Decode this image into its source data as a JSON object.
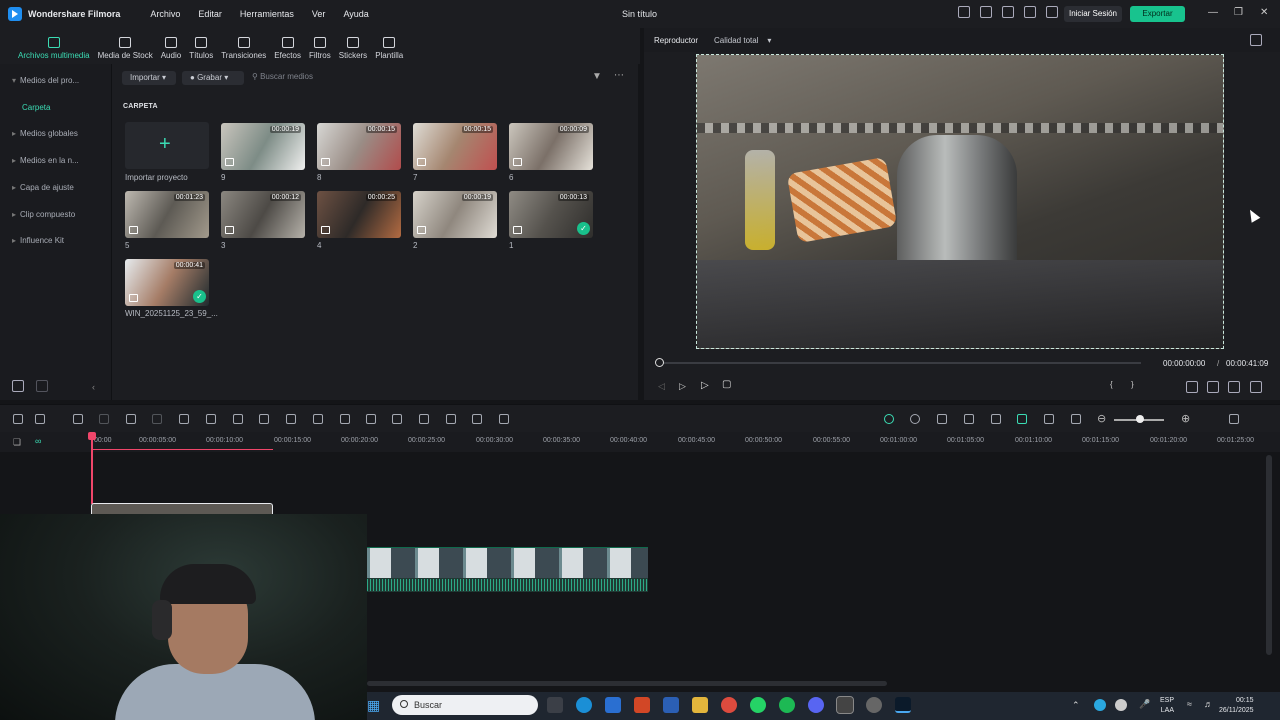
{
  "titlebar": {
    "app_name": "Wondershare Filmora",
    "menu": [
      "Archivo",
      "Editar",
      "Herramientas",
      "Ver",
      "Ayuda"
    ],
    "doc_title": "Sin título",
    "login_label": "Iniciar Sesión",
    "export_label": "Exportar",
    "accent": "#18c38e"
  },
  "media_tabs": [
    {
      "label": "Archivos multimedia",
      "icon": "media-icon"
    },
    {
      "label": "Media de Stock",
      "icon": "stock-icon"
    },
    {
      "label": "Audio",
      "icon": "music-icon"
    },
    {
      "label": "Títulos",
      "icon": "text-icon"
    },
    {
      "label": "Transiciones",
      "icon": "transition-icon"
    },
    {
      "label": "Efectos",
      "icon": "effects-icon"
    },
    {
      "label": "Filtros",
      "icon": "filters-icon"
    },
    {
      "label": "Stickers",
      "icon": "sticker-icon"
    },
    {
      "label": "Plantilla",
      "icon": "template-icon"
    }
  ],
  "sidebar": {
    "items": [
      "Medios del pro...",
      "Carpeta",
      "Medios globales",
      "Medios en la n...",
      "Capa de ajuste",
      "Clip compuesto",
      "Influence Kit"
    ]
  },
  "media": {
    "import_label": "Importar",
    "record_label": "Grabar",
    "search_placeholder": "Buscar medios",
    "folder_heading": "CARPETA",
    "import_card_label": "Importar proyecto",
    "clips": [
      {
        "name": "9",
        "duration": "00:00:19"
      },
      {
        "name": "8",
        "duration": "00:00:15"
      },
      {
        "name": "7",
        "duration": "00:00:15"
      },
      {
        "name": "6",
        "duration": "00:00:09"
      },
      {
        "name": "5",
        "duration": "00:01:23"
      },
      {
        "name": "3",
        "duration": "00:00:12"
      },
      {
        "name": "4",
        "duration": "00:00:25"
      },
      {
        "name": "2",
        "duration": "00:00:19"
      },
      {
        "name": "1",
        "duration": "00:00:13"
      },
      {
        "name": "WIN_20251125_23_59_...",
        "duration": "00:00:41"
      }
    ]
  },
  "player": {
    "title": "Reproductor",
    "quality": "Calidad total",
    "current_time": "00:00:00:00",
    "total_time": "00:00:41:09",
    "separator": "/"
  },
  "timeline": {
    "ticks": [
      "00:00",
      "00:00:05:00",
      "00:00:10:00",
      "00:00:15:00",
      "00:00:20:00",
      "00:00:25:00",
      "00:00:30:00",
      "00:00:35:00",
      "00:00:40:00",
      "00:00:45:00",
      "00:00:50:00",
      "00:00:55:00",
      "00:01:00:00",
      "00:01:05:00",
      "00:01:10:00",
      "00:01:15:00",
      "00:01:20:00",
      "00:01:25:00"
    ]
  },
  "taskbar": {
    "search_placeholder": "Buscar",
    "lang_top": "ESP",
    "lang_bottom": "LAA",
    "time": "00:15",
    "date": "26/11/2025"
  }
}
